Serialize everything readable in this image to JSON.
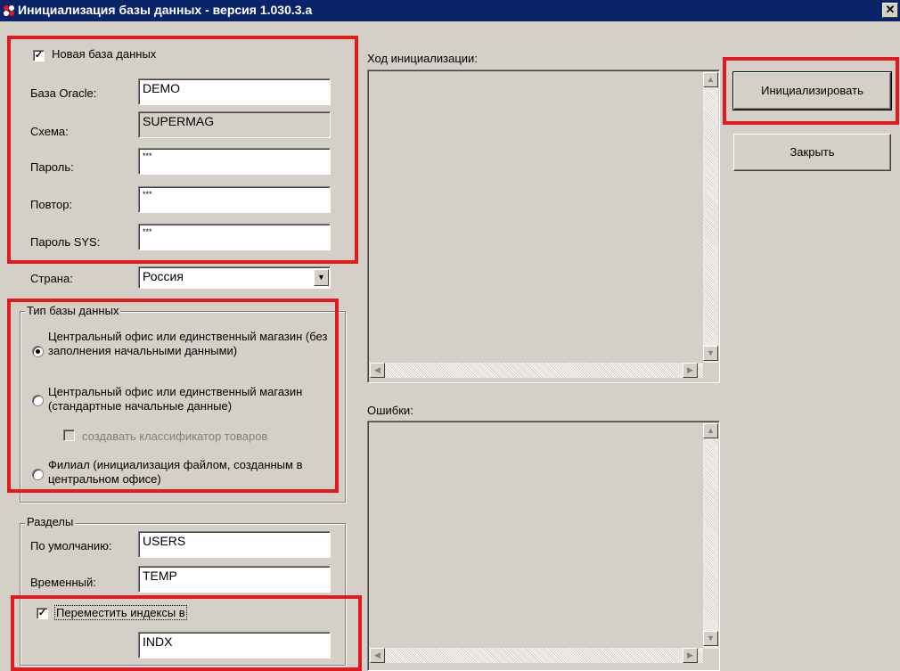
{
  "window": {
    "title": "Инициализация базы данных - версия 1.030.3.a",
    "close_label": "✕"
  },
  "db": {
    "new_db_label": "Новая база данных",
    "new_db_checked": true,
    "oracle_label": "База Oracle:",
    "oracle_value": "DEMO",
    "schema_label": "Схема:",
    "schema_value": "SUPERMAG",
    "password_label": "Пароль:",
    "password_value": "***",
    "repeat_label": "Повтор:",
    "repeat_value": "***",
    "sys_password_label": "Пароль SYS:",
    "sys_password_value": "***",
    "country_label": "Страна:",
    "country_value": "Россия"
  },
  "db_type": {
    "group_label": "Тип базы данных",
    "option1": "Центральный офис или единственный магазин (без заполнения начальными данными)",
    "option2": "Центральный офис или единственный магазин (стандартные начальные данные)",
    "sub_checkbox": "создавать классификатор товаров",
    "option3": "Филиал (инициализация файлом, созданным в центральном офисе)",
    "selected_option": 1
  },
  "sections": {
    "group_label": "Разделы",
    "default_label": "По умолчанию:",
    "default_value": "USERS",
    "temp_label": "Временный:",
    "temp_value": "TEMP",
    "move_indexes_label": "Переместить индексы в",
    "move_indexes_checked": true,
    "indexes_value": "INDX"
  },
  "progress": {
    "label": "Ход инициализации:"
  },
  "errors": {
    "label": "Ошибки:"
  },
  "buttons": {
    "initialize": "Инициализировать",
    "close": "Закрыть"
  },
  "colors": {
    "highlight": "#e3191e",
    "titlebar": "#0a246a",
    "face": "#d4d0c8"
  }
}
